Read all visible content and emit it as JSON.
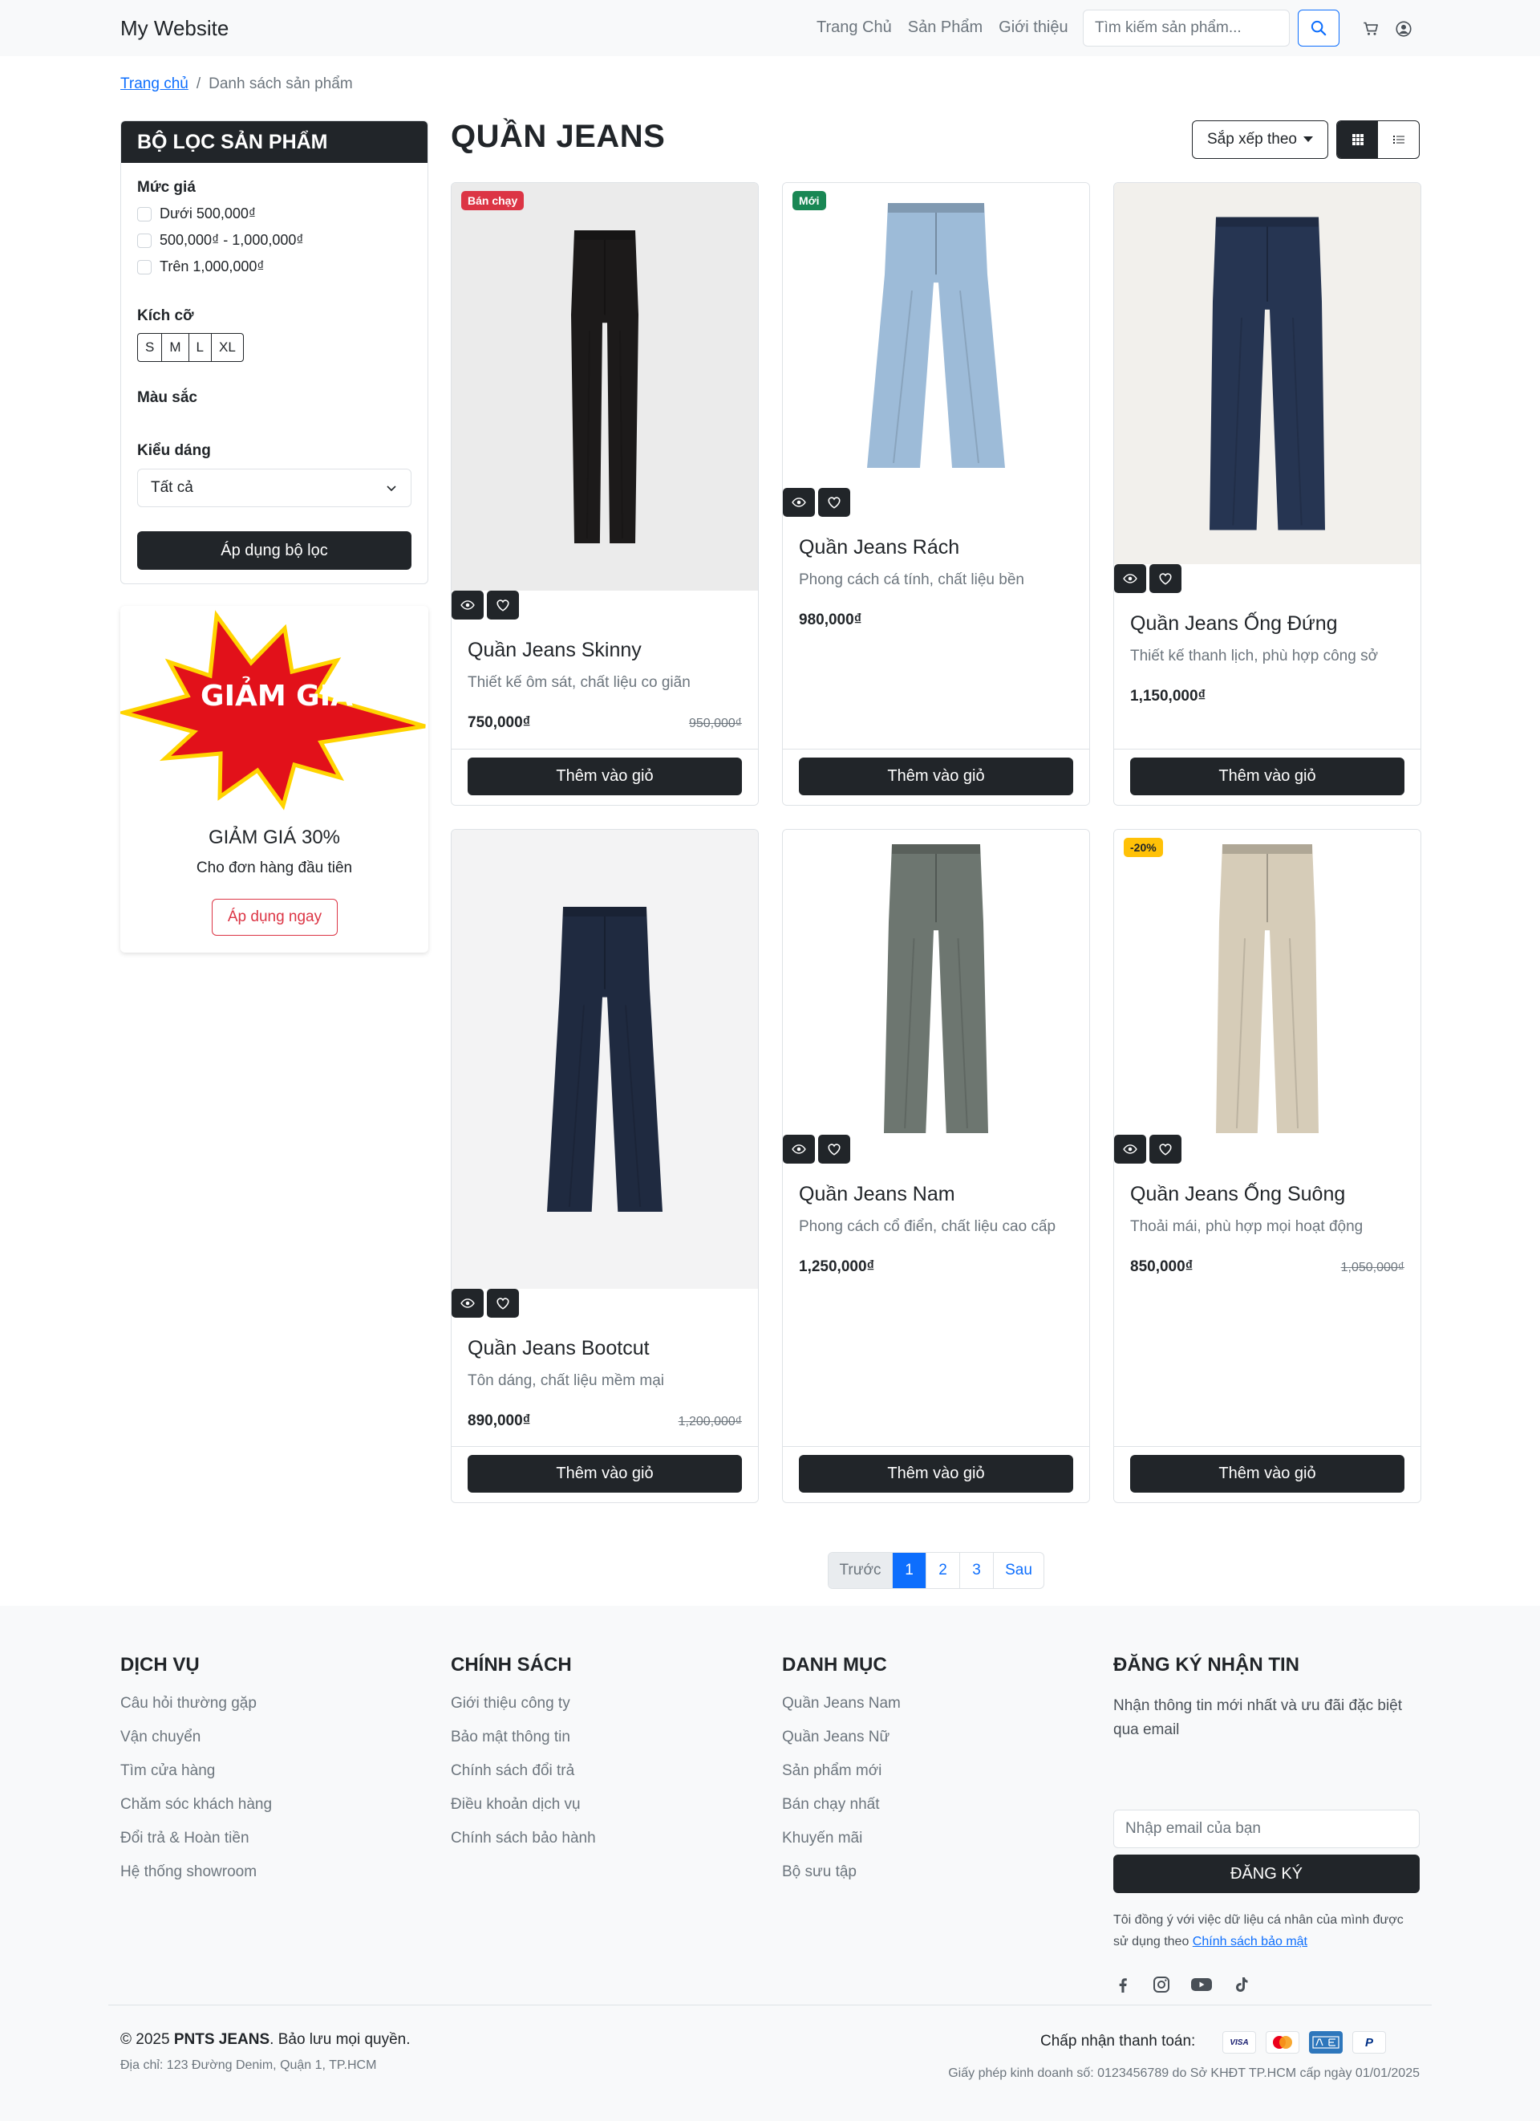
{
  "navbar": {
    "brand": "My Website",
    "links": [
      "Trang Chủ",
      "Sản Phẩm",
      "Giới thiệu"
    ],
    "search_placeholder": "Tìm kiếm sản phẩm..."
  },
  "breadcrumb": {
    "home": "Trang chủ",
    "current": "Danh sách sản phẩm"
  },
  "filter": {
    "title": "BỘ LỌC SẢN PHẨM",
    "price_label": "Mức giá",
    "price_options": [
      "Dưới 500,000₫",
      "500,000₫ - 1,000,000₫",
      "Trên 1,000,000₫"
    ],
    "size_label": "Kích cỡ",
    "sizes": [
      "S",
      "M",
      "L",
      "XL"
    ],
    "color_label": "Màu sắc",
    "style_label": "Kiểu dáng",
    "style_value": "Tất cả",
    "apply_label": "Áp dụng bộ lọc"
  },
  "promo": {
    "burst_text": "GIẢM GIÁ",
    "title": "GIẢM GIÁ 30%",
    "subtitle": "Cho đơn hàng đầu tiên",
    "button": "Áp dụng ngay"
  },
  "main": {
    "title": "QUẦN JEANS",
    "sort_label": "Sắp xếp theo"
  },
  "products": [
    {
      "badge": "Bán chạy",
      "name": "Quần Jeans Skinny",
      "desc": "Thiết kế ôm sát, chất liệu co giãn",
      "price": "750,000₫",
      "old_price": "950,000₫",
      "button": "Thêm vào giỏ",
      "jean_color": "#1c1a1a"
    },
    {
      "badge": "Mới",
      "name": "Quần Jeans Rách",
      "desc": "Phong cách cá tính, chất liệu bền",
      "price": "980,000₫",
      "old_price": "",
      "button": "Thêm vào giỏ",
      "jean_color": "#9dbbd8"
    },
    {
      "badge": "",
      "name": "Quần Jeans Ống Đứng",
      "desc": "Thiết kế thanh lịch, phù hợp công sở",
      "price": "1,150,000₫",
      "old_price": "",
      "button": "Thêm vào giỏ",
      "jean_color": "#263552"
    },
    {
      "badge": "",
      "name": "Quần Jeans Bootcut",
      "desc": "Tôn dáng, chất liệu mềm mại",
      "price": "890,000₫",
      "old_price": "1,200,000₫",
      "button": "Thêm vào giỏ",
      "jean_color": "#1f2a40"
    },
    {
      "badge": "",
      "name": "Quần Jeans Nam",
      "desc": "Phong cách cổ điển, chất liệu cao cấp",
      "price": "1,250,000₫",
      "old_price": "",
      "button": "Thêm vào giỏ",
      "jean_color": "#6d7670"
    },
    {
      "badge": "-20%",
      "name": "Quần Jeans Ống Suông",
      "desc": "Thoải mái, phù hợp mọi hoạt động",
      "price": "850,000₫",
      "old_price": "1,050,000₫",
      "button": "Thêm vào giỏ",
      "jean_color": "#d6ccb8"
    }
  ],
  "pagination": {
    "prev": "Trước",
    "pages": [
      "1",
      "2",
      "3"
    ],
    "next": "Sau"
  },
  "footer": {
    "services": {
      "title": "DỊCH VỤ",
      "links": [
        "Câu hỏi thường gặp",
        "Vận chuyển",
        "Tìm cửa hàng",
        "Chăm sóc khách hàng",
        "Đổi trả & Hoàn tiền",
        "Hệ thống showroom"
      ]
    },
    "policies": {
      "title": "CHÍNH SÁCH",
      "links": [
        "Giới thiệu công ty",
        "Bảo mật thông tin",
        "Chính sách đổi trả",
        "Điều khoản dịch vụ",
        "Chính sách bảo hành"
      ]
    },
    "categories": {
      "title": "DANH MỤC",
      "links": [
        "Quần Jeans Nam",
        "Quần Jeans Nữ",
        "Sản phẩm mới",
        "Bán chạy nhất",
        "Khuyến mãi",
        "Bộ sưu tập"
      ]
    },
    "newsletter": {
      "title": "ĐĂNG KÝ NHẬN TIN",
      "text": "Nhận thông tin mới nhất và ưu đãi đặc biệt qua email",
      "placeholder": "Nhập email của bạn",
      "button": "ĐĂNG KÝ",
      "consent": "Tôi đồng ý với việc dữ liệu cá nhân của mình được sử dụng theo",
      "consent_link": "Chính sách bảo mật"
    },
    "copyright_prefix": "© 2025",
    "brand": "PNTS JEANS",
    "copyright_suffix": ". Bảo lưu mọi quyền.",
    "address": "Địa chỉ: 123 Đường Denim, Quận 1, TP.HCM",
    "payment_label": "Chấp nhận thanh toán:",
    "payment_visa": "VISA",
    "payment_paypal": "P",
    "license": "Giấy phép kinh doanh số: 0123456789 do Sở KHĐT TP.HCM cấp ngày 01/01/2025"
  }
}
